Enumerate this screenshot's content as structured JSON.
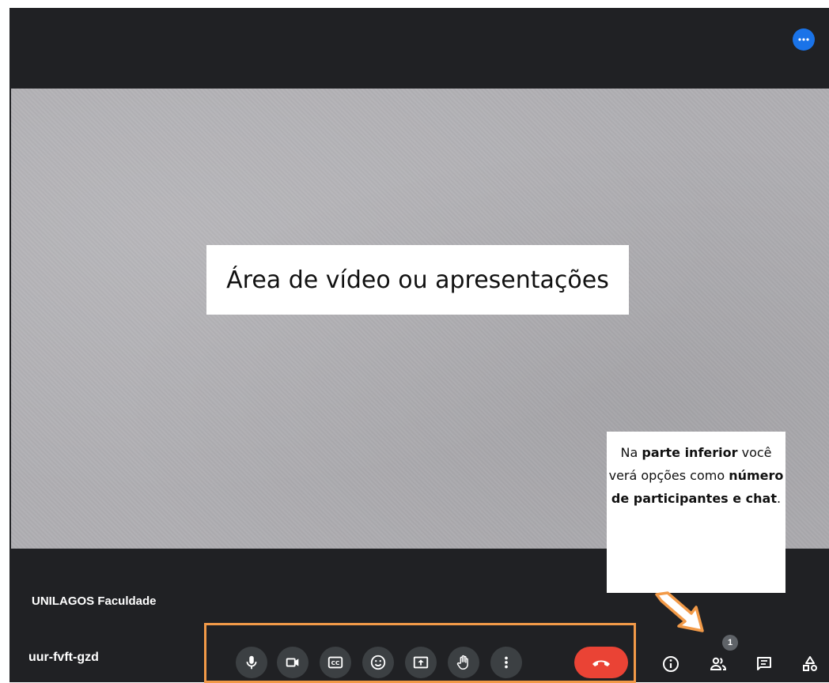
{
  "stage": {
    "video_label": "Área de vídeo ou apresentações",
    "participant_name": "UNILAGOS Faculdade"
  },
  "tooltip": {
    "segments": [
      {
        "text": "Na ",
        "bold": false
      },
      {
        "text": "parte inferior",
        "bold": true
      },
      {
        "text": " você verá opções como ",
        "bold": false
      },
      {
        "text": "número de participantes e chat",
        "bold": true
      },
      {
        "text": ".",
        "bold": false
      }
    ]
  },
  "footer": {
    "meeting_code": "uur-fvft-gzd",
    "participant_count": "1"
  },
  "icons": {
    "more_options": "more-horizontal-icon",
    "controls": [
      "microphone-icon",
      "camera-icon",
      "captions-icon",
      "emoji-icon",
      "present-screen-icon",
      "raise-hand-icon",
      "more-vertical-icon",
      "end-call-icon"
    ],
    "side": [
      "info-icon",
      "people-icon",
      "chat-icon",
      "activities-icon"
    ]
  },
  "colors": {
    "background": "#202124",
    "control_button": "#3c4043",
    "end_call": "#ea4335",
    "accent": "#1a73e8",
    "highlight": "#f29a48"
  }
}
